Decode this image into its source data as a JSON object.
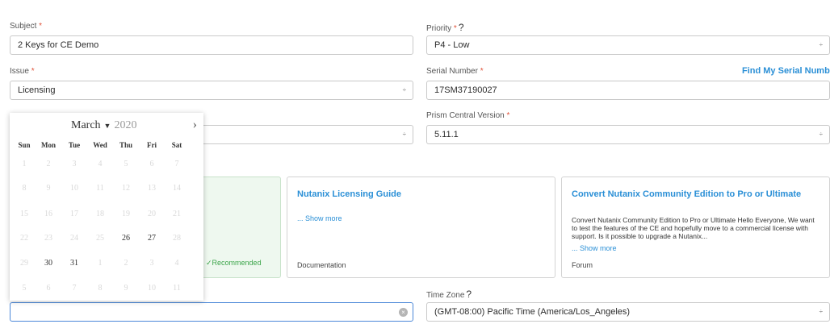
{
  "form": {
    "subject": {
      "label": "Subject",
      "required": "*",
      "value": "2 Keys for CE Demo"
    },
    "priority": {
      "label": "Priority",
      "required": "*",
      "help": "?",
      "value": "P4 - Low"
    },
    "issue": {
      "label": "Issue",
      "required": "*",
      "value": "Licensing"
    },
    "serial": {
      "label": "Serial Number",
      "required": "*",
      "value": "17SM37190027",
      "link": "Find My Serial Number"
    },
    "version_select": {
      "value": ""
    },
    "prism": {
      "label": "Prism Central Version",
      "required": "*",
      "value": "5.11.1"
    },
    "timezone": {
      "label": "Time Zone",
      "help": "?",
      "value": "(GMT-08:00) Pacific Time (America/Los_Angeles)"
    },
    "date_input": {
      "value": ""
    },
    "select_glyph": "÷",
    "clear_glyph": "×"
  },
  "cards": {
    "first": {
      "recommended": "✓Recommended"
    },
    "guide": {
      "title": "Nutanix Licensing Guide",
      "more": "... Show more",
      "foot": "Documentation"
    },
    "convert": {
      "title": "Convert Nutanix Community Edition to Pro or Ultimate",
      "desc": "Convert Nutanix Community Edition to Pro or Ultimate Hello Everyone, We want to test the features of the CE and hopefully move to a commercial license with support. Is it possible to upgrade a Nutanix...",
      "more": "... Show more",
      "foot": "Forum"
    }
  },
  "calendar": {
    "month": "March",
    "month_arrow": "▼",
    "year": "2020",
    "next": "›",
    "weekdays": [
      "Sun",
      "Mon",
      "Tue",
      "Wed",
      "Thu",
      "Fri",
      "Sat"
    ],
    "weeks": [
      [
        "1",
        "2",
        "3",
        "4",
        "5",
        "6",
        "7"
      ],
      [
        "8",
        "9",
        "10",
        "11",
        "12",
        "13",
        "14"
      ],
      [
        "15",
        "16",
        "17",
        "18",
        "19",
        "20",
        "21"
      ],
      [
        "22",
        "23",
        "24",
        "25",
        "26",
        "27",
        "28"
      ],
      [
        "29",
        "30",
        "31",
        "1",
        "2",
        "3",
        "4"
      ],
      [
        "5",
        "6",
        "7",
        "8",
        "9",
        "10",
        "11"
      ]
    ],
    "enabled": [
      "26",
      "27",
      "30",
      "31"
    ]
  }
}
